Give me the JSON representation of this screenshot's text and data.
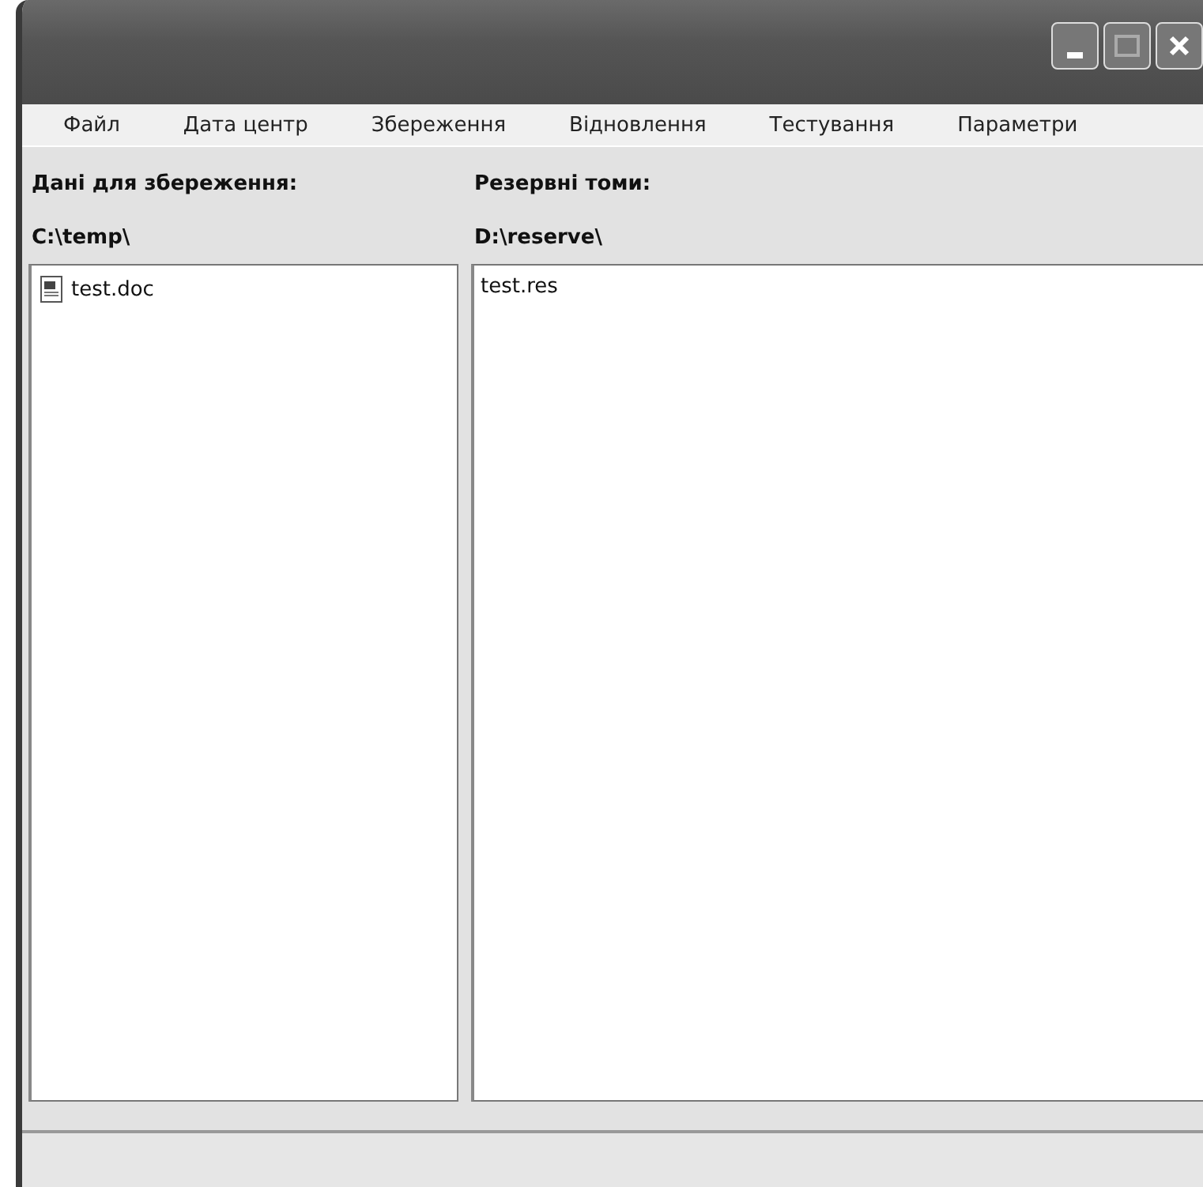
{
  "menu": [
    "Файл",
    "Дата центр",
    "Збереження",
    "Відновлення",
    "Тестування",
    "Параметри"
  ],
  "left_panel": {
    "heading": "Дані для збереження:",
    "path": "C:\\temp\\",
    "files": [
      {
        "name": "test.doc"
      }
    ]
  },
  "right_panel": {
    "heading": "Резервні томи:",
    "path": "D:\\reserve\\",
    "files": [
      {
        "name": "test.res"
      }
    ]
  }
}
